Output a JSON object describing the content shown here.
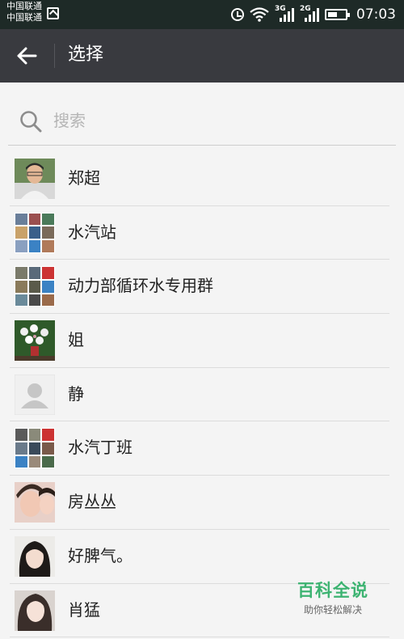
{
  "status_bar": {
    "carrier_1": "中国联通",
    "carrier_2": "中国联通",
    "net_1": "3G",
    "net_2": "2G",
    "time": "07:03",
    "battery_level": 0.55
  },
  "header": {
    "title": "选择",
    "back_icon": "arrow-left-icon"
  },
  "search": {
    "placeholder": "搜索",
    "icon": "search-icon"
  },
  "contacts": [
    {
      "name": "郑超",
      "avatar": "photo-man"
    },
    {
      "name": "水汽站",
      "avatar": "group-grid"
    },
    {
      "name": "动力部循环水专用群",
      "avatar": "group-grid"
    },
    {
      "name": "姐",
      "avatar": "photo-flowers"
    },
    {
      "name": "静",
      "avatar": "default-person"
    },
    {
      "name": "水汽丁班",
      "avatar": "group-grid"
    },
    {
      "name": "房丛丛",
      "avatar": "photo-woman"
    },
    {
      "name": "好脾气。",
      "avatar": "photo-woman"
    },
    {
      "name": "肖猛",
      "avatar": "photo-woman"
    }
  ],
  "watermark": {
    "title": "百科全说",
    "subtitle": "助你轻松解决"
  },
  "colors": {
    "status_bar": "#1e2a27",
    "title_bar": "#393a3f",
    "background": "#f4f4f4",
    "watermark_green": "#3cb371"
  }
}
